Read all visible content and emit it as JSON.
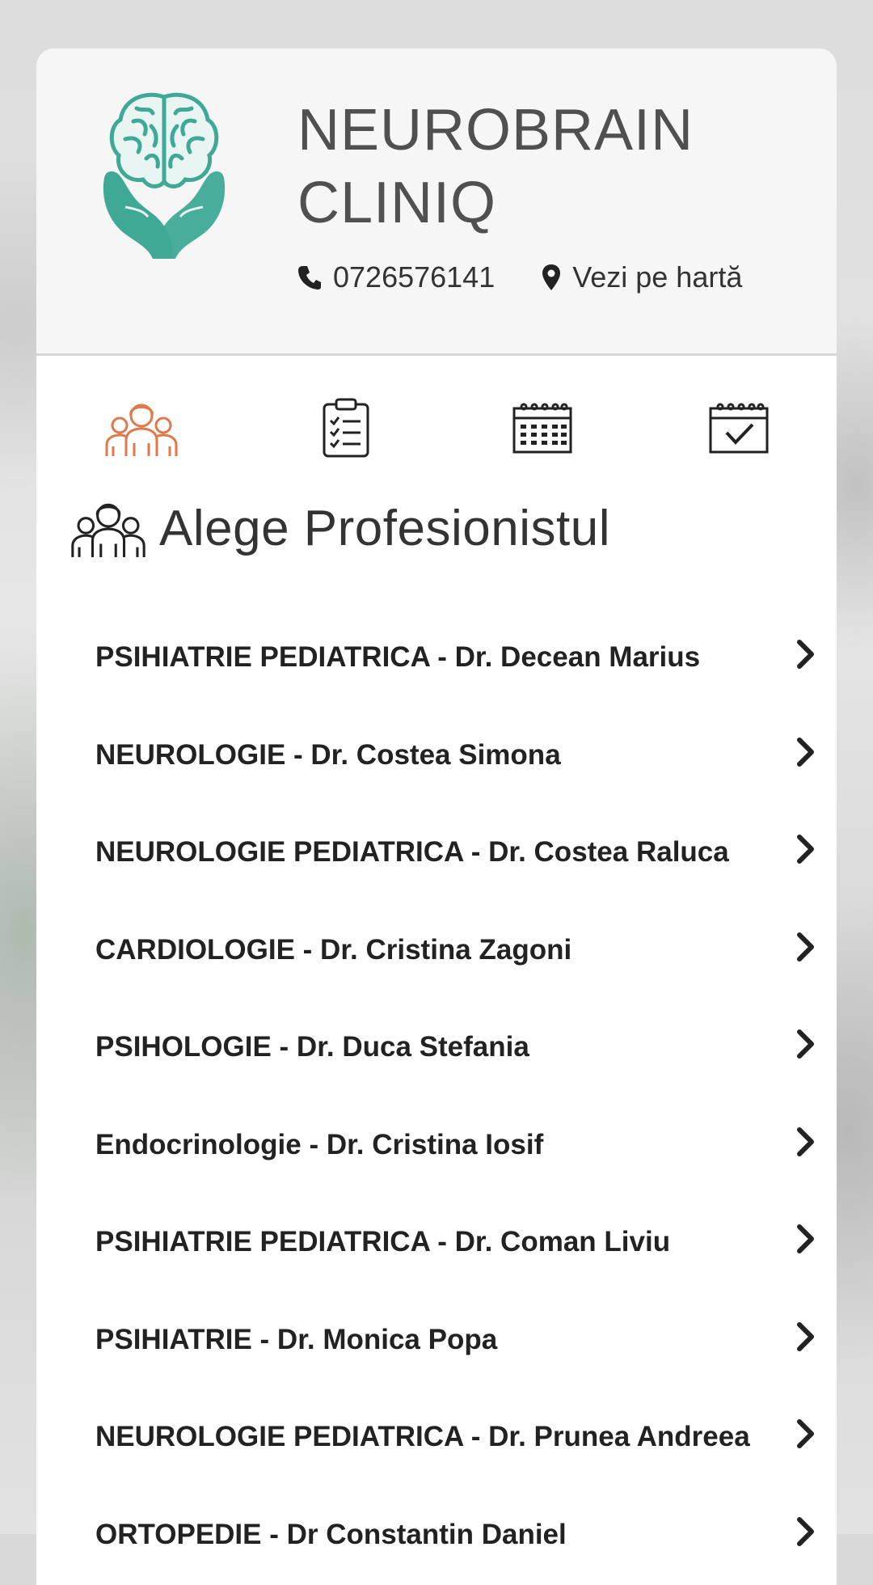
{
  "clinic": {
    "name": "NEUROBRAIN CLINIQ",
    "phone": "0726576141",
    "map_link": "Vezi pe hartă"
  },
  "tabs": [
    {
      "icon": "professionals-icon",
      "active": true
    },
    {
      "icon": "clipboard-checklist-icon",
      "active": false
    },
    {
      "icon": "calendar-icon",
      "active": false
    },
    {
      "icon": "calendar-check-icon",
      "active": false
    }
  ],
  "section": {
    "title": "Alege Profesionistul",
    "icon": "professionals-icon"
  },
  "professionals": [
    "PSIHIATRIE PEDIATRICA - Dr. Decean Marius",
    "NEUROLOGIE - Dr. Costea Simona",
    "NEUROLOGIE PEDIATRICA - Dr. Costea Raluca",
    "CARDIOLOGIE - Dr. Cristina Zagoni",
    "PSIHOLOGIE - Dr. Duca Stefania",
    "Endocrinologie - Dr. Cristina Iosif",
    "PSIHIATRIE PEDIATRICA - Dr. Coman Liviu",
    "PSIHIATRIE - Dr. Monica Popa",
    "NEUROLOGIE PEDIATRICA - Dr. Prunea Andreea",
    "ORTOPEDIE - Dr Constantin Daniel"
  ],
  "colors": {
    "accent": "#e0784a",
    "logo": "#3fa996",
    "text": "#222222",
    "header_bg": "#f6f6f6"
  }
}
